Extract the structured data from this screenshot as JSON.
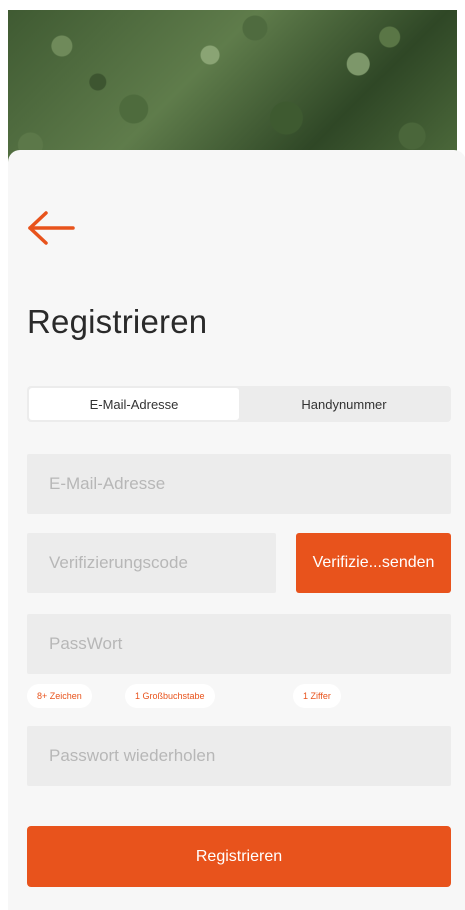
{
  "colors": {
    "accent": "#e8531c",
    "card_background": "#f7f7f7",
    "field_background": "#ececec"
  },
  "header": {
    "back_icon": "arrow-left-icon",
    "title": "Registrieren"
  },
  "tabs": [
    {
      "label": "E-Mail-Adresse",
      "active": true
    },
    {
      "label": "Handynummer",
      "active": false
    }
  ],
  "form": {
    "email_placeholder": "E-Mail-Adresse",
    "code_placeholder": "Verifizierungscode",
    "send_code_label": "Verifizie...senden",
    "password_placeholder": "PassWort",
    "password_hints": [
      "8+ Zeichen",
      "1 Großbuchstabe",
      "1 Ziffer"
    ],
    "repeat_placeholder": "Passwort wiederholen",
    "submit_label": "Registrieren"
  }
}
